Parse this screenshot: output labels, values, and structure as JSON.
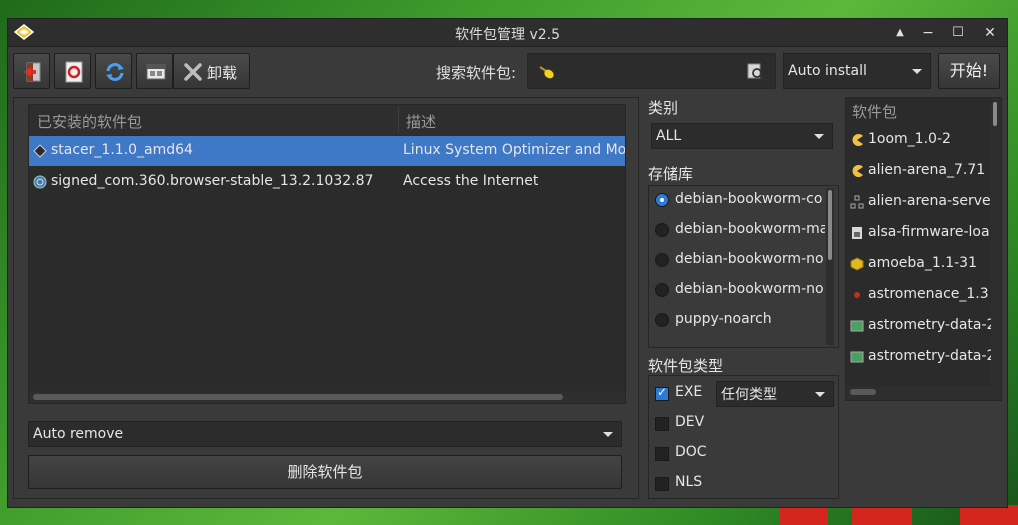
{
  "window": {
    "title": "软件包管理 v2.5"
  },
  "toolbar": {
    "uninstall_label": "卸载",
    "search_label": "搜索软件包:",
    "search_value": "",
    "install_mode": "Auto install",
    "start_label": "开始!"
  },
  "installed": {
    "headers": {
      "name": "已安装的软件包",
      "desc": "描述"
    },
    "rows": [
      {
        "name": "stacer_1.1.0_amd64",
        "desc": "Linux System Optimizer and Mo"
      },
      {
        "name": "signed_com.360.browser-stable_13.2.1032.87",
        "desc": "Access the Internet"
      }
    ],
    "remove_mode": "Auto remove",
    "delete_label": "删除软件包"
  },
  "category": {
    "title": "类别",
    "value": "ALL"
  },
  "repos": {
    "title": "存储库",
    "items": [
      {
        "label": "debian-bookworm-co",
        "selected": true
      },
      {
        "label": "debian-bookworm-ma",
        "selected": false
      },
      {
        "label": "debian-bookworm-no",
        "selected": false
      },
      {
        "label": "debian-bookworm-no",
        "selected": false
      },
      {
        "label": "puppy-noarch",
        "selected": false
      }
    ]
  },
  "pkgtype": {
    "title": "软件包类型",
    "checks": [
      {
        "label": "EXE",
        "checked": true
      },
      {
        "label": "DEV",
        "checked": false
      },
      {
        "label": "DOC",
        "checked": false
      },
      {
        "label": "NLS",
        "checked": false
      }
    ],
    "type_value": "任何类型"
  },
  "packages": {
    "header": "软件包",
    "items": [
      "1oom_1.0-2",
      "alien-arena_7.71",
      "alien-arena-serve",
      "alsa-firmware-loa",
      "amoeba_1.1-31",
      "astromenace_1.3",
      "astrometry-data-2",
      "astrometry-data-2"
    ]
  },
  "colors": {
    "selection": "#3e78c6",
    "accent": "#2d7bd6"
  }
}
